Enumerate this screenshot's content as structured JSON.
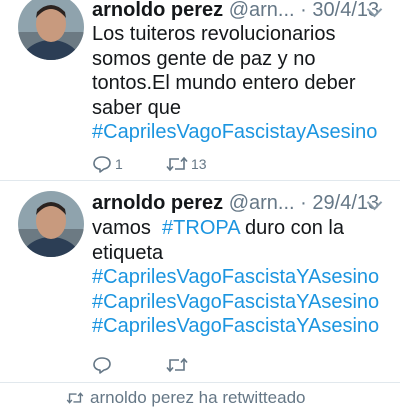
{
  "tweets": [
    {
      "name": "arnoldo perez",
      "handle": "@arn...",
      "separator": "·",
      "date": "30/4/13",
      "lines": [
        "Los tuiteros revolucionarios",
        "somos gente de paz y no",
        "tontos.El mundo entero deber",
        "saber que"
      ],
      "hashtag": "#CaprilesVagoFascistayAsesino",
      "reply_count": "1",
      "retweet_count": "13"
    },
    {
      "name": "arnoldo perez",
      "handle": "@arn...",
      "separator": "·",
      "date": "29/4/13",
      "line1_prefix": "vamos",
      "line1_tag": "#TROPA",
      "line1_suffix": "duro con la",
      "line2": "etiqueta",
      "hashtags": [
        "#CaprilesVagoFascistaYAsesino",
        "#CaprilesVagoFascistaYAsesino",
        "#CaprilesVagoFascistaYAsesino"
      ],
      "reply_count": "",
      "retweet_count": ""
    }
  ],
  "footer": {
    "text": "arnoldo perez ha retwitteado"
  },
  "colors": {
    "link": "#1b95e0",
    "muted": "#657786",
    "text": "#14171a",
    "divider": "#e1e8ed"
  },
  "icons": [
    "reply-icon",
    "retweet-icon",
    "chevron-down-icon",
    "avatar"
  ]
}
